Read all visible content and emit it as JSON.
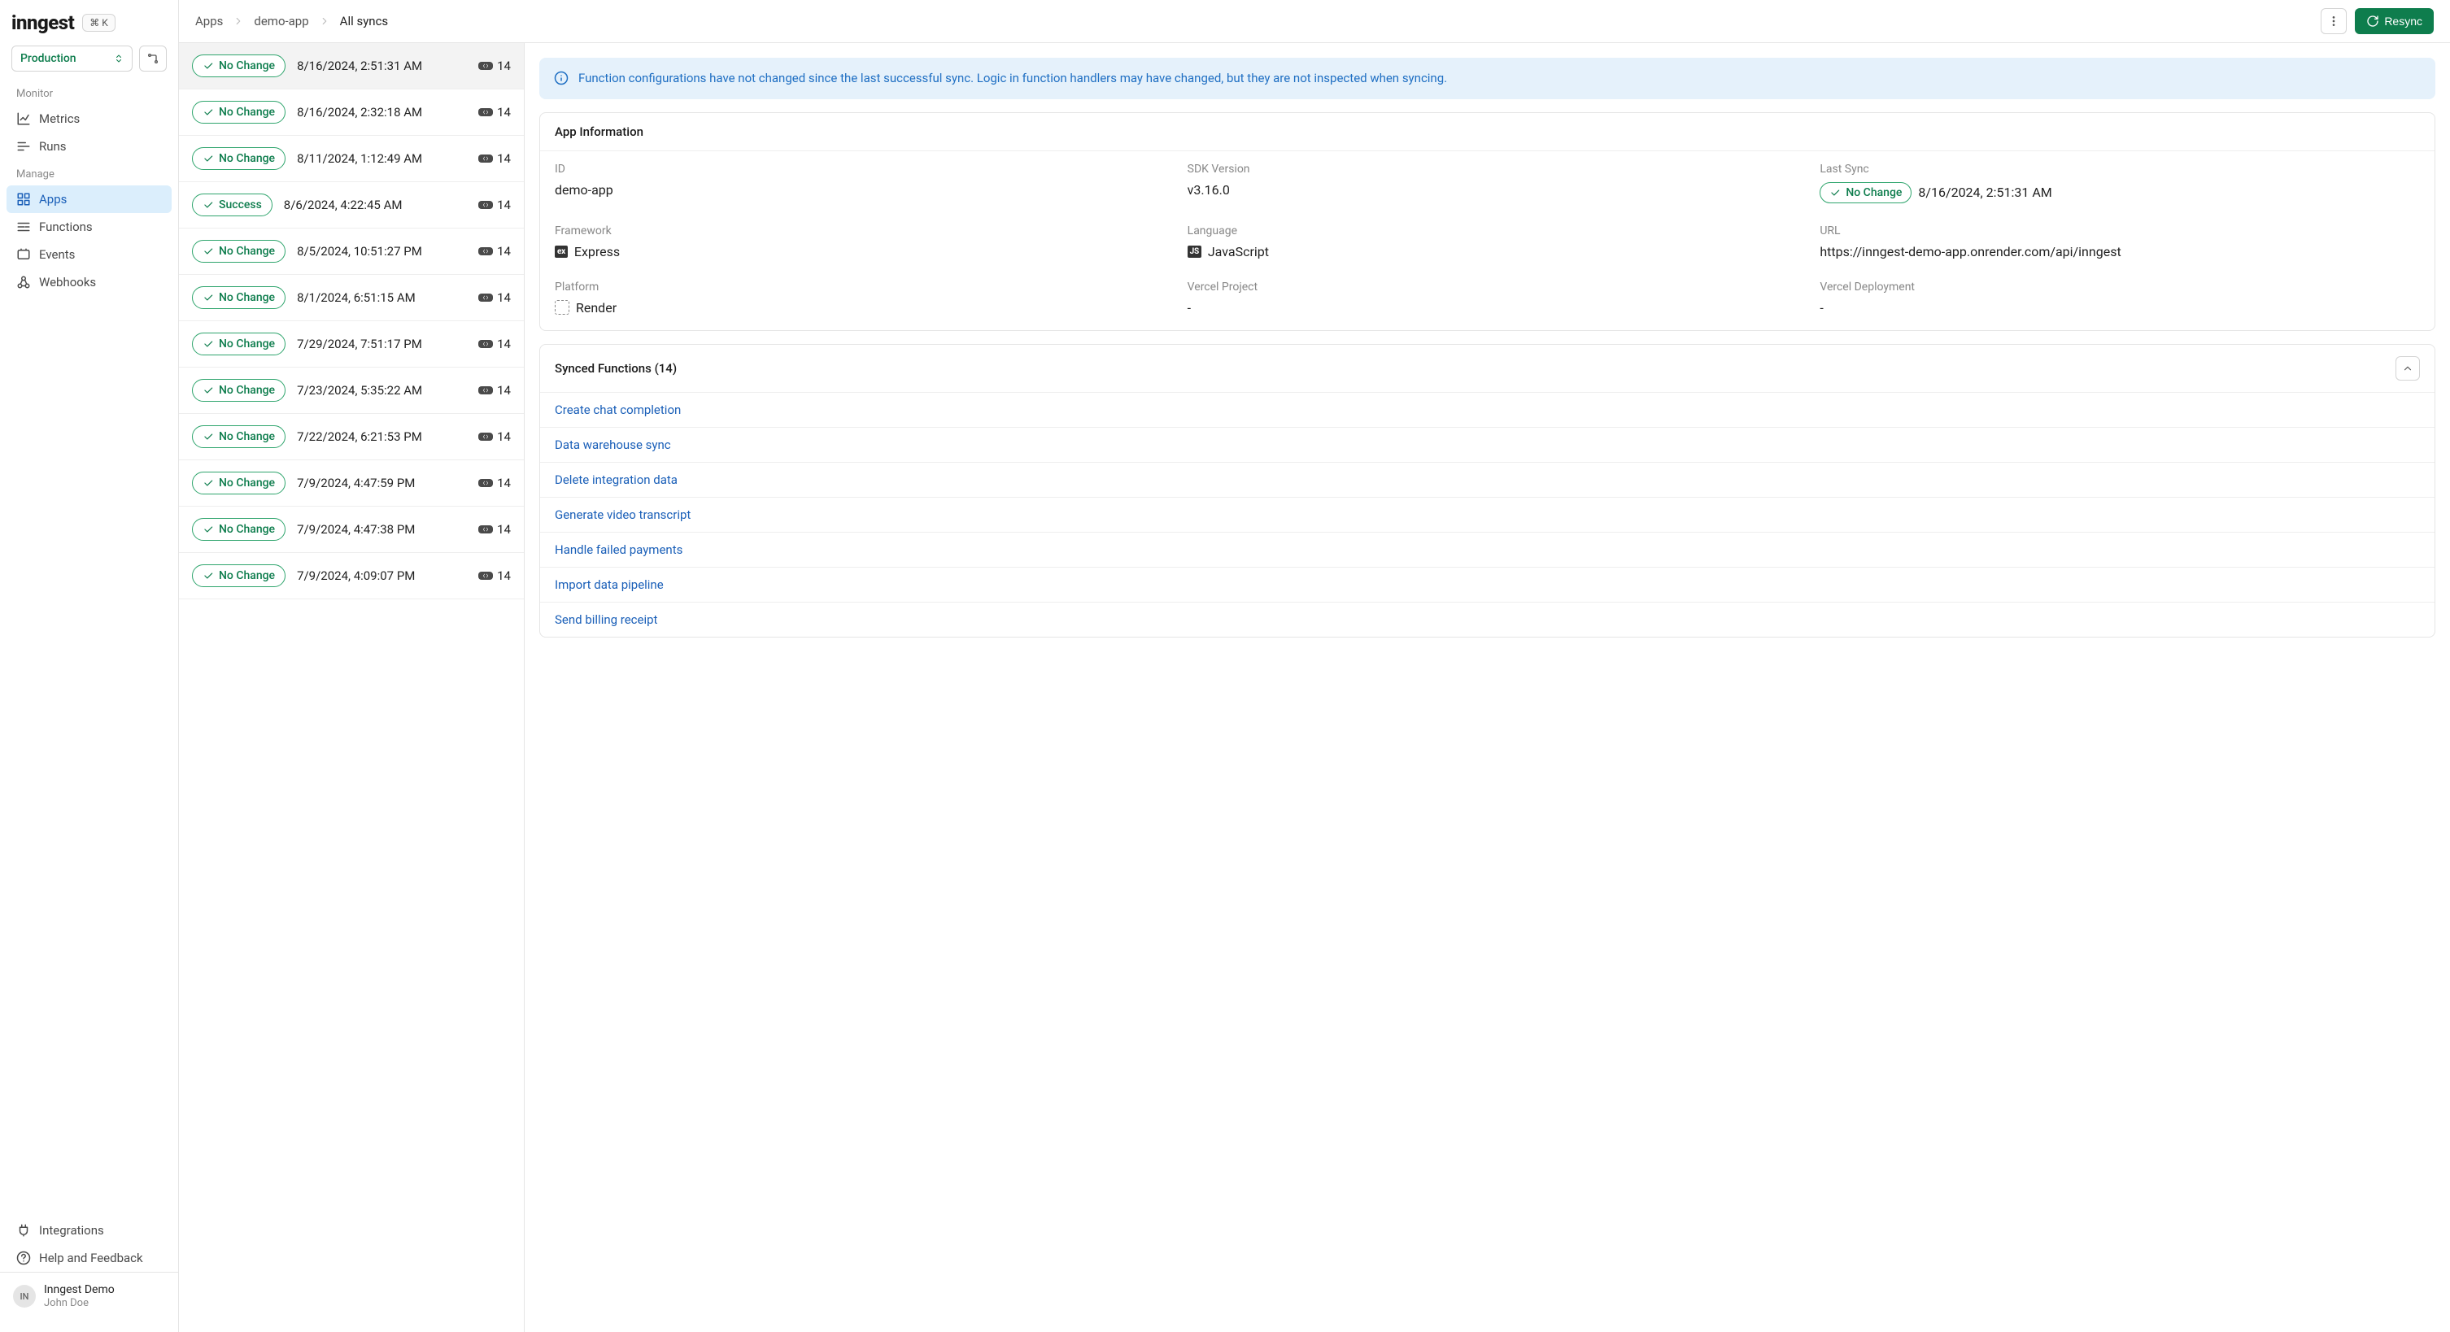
{
  "logo_text": "inngest",
  "kbd_text": "⌘ K",
  "env": {
    "label": "Production"
  },
  "sections": {
    "monitor": "Monitor",
    "manage": "Manage"
  },
  "nav": {
    "metrics": "Metrics",
    "runs": "Runs",
    "apps": "Apps",
    "functions": "Functions",
    "events": "Events",
    "webhooks": "Webhooks",
    "integrations": "Integrations",
    "help": "Help and Feedback"
  },
  "user": {
    "avatar": "IN",
    "org": "Inngest Demo",
    "name": "John Doe"
  },
  "breadcrumbs": [
    "Apps",
    "demo-app",
    "All syncs"
  ],
  "resync_label": "Resync",
  "syncs": [
    {
      "status": "No Change",
      "date": "8/16/2024, 2:51:31 AM",
      "count": "14",
      "active": true
    },
    {
      "status": "No Change",
      "date": "8/16/2024, 2:32:18 AM",
      "count": "14"
    },
    {
      "status": "No Change",
      "date": "8/11/2024, 1:12:49 AM",
      "count": "14"
    },
    {
      "status": "Success",
      "date": "8/6/2024, 4:22:45 AM",
      "count": "14"
    },
    {
      "status": "No Change",
      "date": "8/5/2024, 10:51:27 PM",
      "count": "14"
    },
    {
      "status": "No Change",
      "date": "8/1/2024, 6:51:15 AM",
      "count": "14"
    },
    {
      "status": "No Change",
      "date": "7/29/2024, 7:51:17 PM",
      "count": "14"
    },
    {
      "status": "No Change",
      "date": "7/23/2024, 5:35:22 AM",
      "count": "14"
    },
    {
      "status": "No Change",
      "date": "7/22/2024, 6:21:53 PM",
      "count": "14"
    },
    {
      "status": "No Change",
      "date": "7/9/2024, 4:47:59 PM",
      "count": "14"
    },
    {
      "status": "No Change",
      "date": "7/9/2024, 4:47:38 PM",
      "count": "14"
    },
    {
      "status": "No Change",
      "date": "7/9/2024, 4:09:07 PM",
      "count": "14"
    }
  ],
  "notice": "Function configurations have not changed since the last successful sync. Logic in function handlers may have changed, but they are not inspected when syncing.",
  "app_info_title": "App Information",
  "app_info": {
    "id_label": "ID",
    "id_value": "demo-app",
    "sdk_label": "SDK Version",
    "sdk_value": "v3.16.0",
    "lastsync_label": "Last Sync",
    "lastsync_status": "No Change",
    "lastsync_date": "8/16/2024, 2:51:31 AM",
    "framework_label": "Framework",
    "framework_value": "Express",
    "language_label": "Language",
    "language_value": "JavaScript",
    "url_label": "URL",
    "url_value": "https://inngest-demo-app.onrender.com/api/inngest",
    "platform_label": "Platform",
    "platform_value": "Render",
    "vproj_label": "Vercel Project",
    "vproj_value": "-",
    "vdep_label": "Vercel Deployment",
    "vdep_value": "-"
  },
  "synced_functions_title": "Synced Functions (14)",
  "functions": [
    "Create chat completion",
    "Data warehouse sync",
    "Delete integration data",
    "Generate video transcript",
    "Handle failed payments",
    "Import data pipeline",
    "Send billing receipt"
  ]
}
